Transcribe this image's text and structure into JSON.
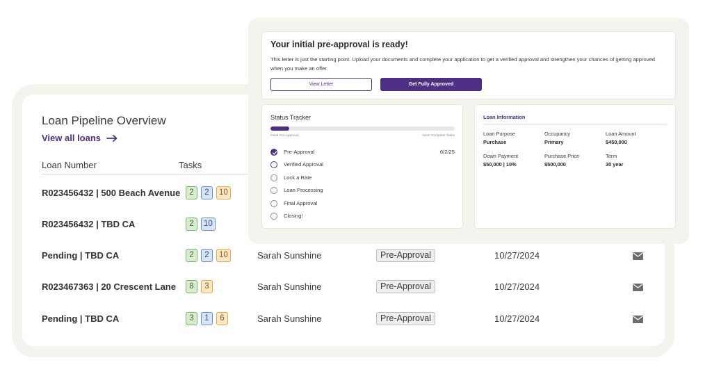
{
  "pipeline": {
    "title": "Loan Pipeline Overview",
    "view_all": "View all loans",
    "columns": {
      "loan_number": "Loan Number",
      "tasks": "Tasks"
    },
    "rows": [
      {
        "loan": "R023456432 | 500 Beach Avenue",
        "tasks": [
          "2",
          "2",
          "10"
        ],
        "officer": "",
        "stage": "",
        "date": ""
      },
      {
        "loan": "R023456432 | TBD CA",
        "tasks": [
          "2",
          "10"
        ],
        "officer": "",
        "stage": "",
        "date": ""
      },
      {
        "loan": "Pending | TBD CA",
        "tasks": [
          "2",
          "2",
          "10"
        ],
        "officer": "Sarah Sunshine",
        "stage": "Pre-Approval",
        "date": "10/27/2024"
      },
      {
        "loan": "R023467363 | 20 Crescent Lane",
        "tasks": [
          "8",
          "3"
        ],
        "officer": "Sarah Sunshine",
        "stage": "Pre-Approval",
        "date": "10/27/2024"
      },
      {
        "loan": "Pending | TBD CA",
        "tasks": [
          "3",
          "1",
          "6"
        ],
        "officer": "Sarah Sunshine",
        "stage": "Pre-Approval",
        "date": "10/27/2024"
      }
    ]
  },
  "preapproval": {
    "title": "Your initial pre-approval is ready!",
    "body": "This letter is just the starting point. Upload your documents and complete your application to get a verified approval and strengthen your chances of getting approved when you make an offer.",
    "view_letter": "View Letter",
    "get_approved": "Get Fully Approved"
  },
  "status_tracker": {
    "title": "Status Tracker",
    "progress": 0.1,
    "progress_left": "Initial Pre-Approval",
    "progress_right": "Next: Complete Tasks",
    "steps": [
      {
        "label": "Pre-Approval",
        "state": "done",
        "date": "6/2/25"
      },
      {
        "label": "Verified Approval",
        "state": "active",
        "date": ""
      },
      {
        "label": "Lock a Rate",
        "state": "todo",
        "date": ""
      },
      {
        "label": "Loan Processing",
        "state": "todo",
        "date": ""
      },
      {
        "label": "Final Approval",
        "state": "todo",
        "date": ""
      },
      {
        "label": "Closing!",
        "state": "todo",
        "date": ""
      }
    ]
  },
  "loan_info": {
    "title": "Loan Information",
    "fields": [
      {
        "label": "Loan Purpose",
        "value": "Purchase"
      },
      {
        "label": "Occupancy",
        "value": "Primary"
      },
      {
        "label": "Loan Amount",
        "value": "$450,000"
      },
      {
        "label": "Down Payment",
        "value": "$50,000 | 10%"
      },
      {
        "label": "Purchase Price",
        "value": "$500,000"
      },
      {
        "label": "Term",
        "value": "30 year"
      }
    ]
  },
  "icons": {
    "arrow": "arrow-right-icon",
    "mail": "envelope-icon",
    "check": "check-icon"
  },
  "colors": {
    "brand": "#4d2f86",
    "green_chip": "#d8ecd0",
    "blue_chip": "#d6e3f8",
    "orange_chip": "#fde7c4"
  }
}
